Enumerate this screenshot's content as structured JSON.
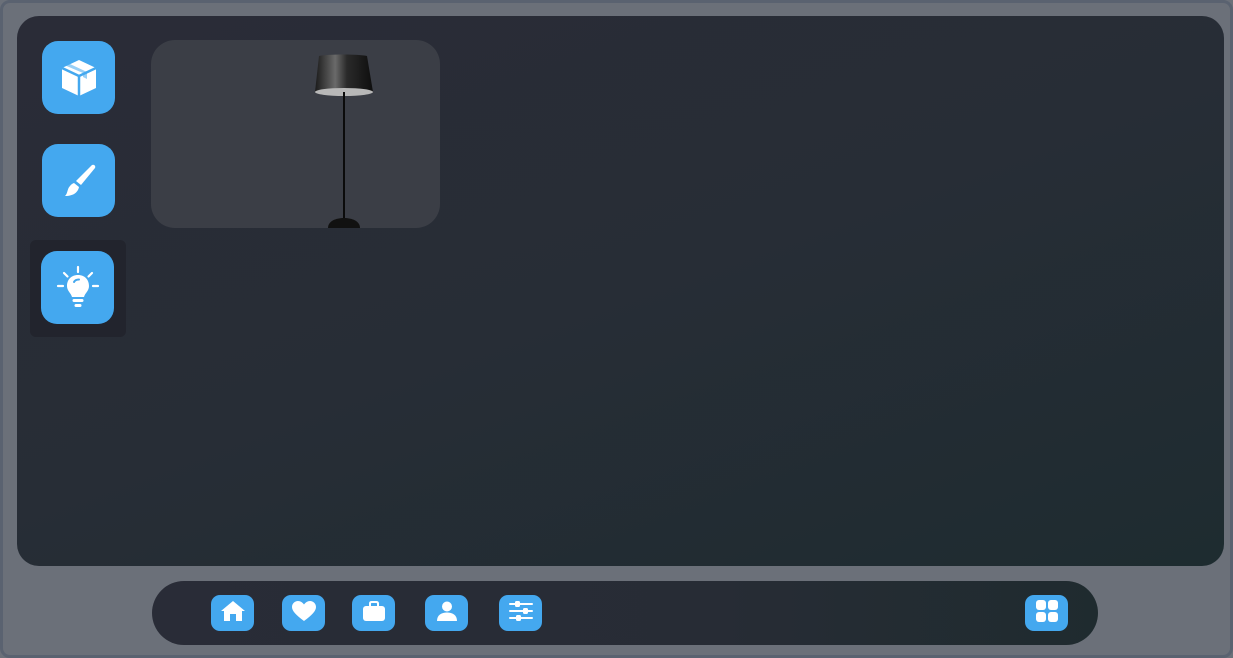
{
  "colors": {
    "accent": "#44a8ef",
    "outer_background": "#6b7079",
    "panel_background": "#272d36",
    "selected_tool_background": "#22242d",
    "card_background": "#3b3e46"
  },
  "tools": [
    {
      "icon": "box-icon",
      "selected": false
    },
    {
      "icon": "paintbrush-icon",
      "selected": false
    },
    {
      "icon": "lightbulb-icon",
      "selected": true
    }
  ],
  "catalog": {
    "items": [
      {
        "image": "floor-lamp-image"
      }
    ]
  },
  "bottom_nav": {
    "items": [
      {
        "icon": "home-icon"
      },
      {
        "icon": "heart-icon"
      },
      {
        "icon": "briefcase-icon"
      },
      {
        "icon": "user-icon"
      },
      {
        "icon": "sliders-icon"
      }
    ],
    "grid_button": {
      "icon": "grid-icon"
    }
  }
}
